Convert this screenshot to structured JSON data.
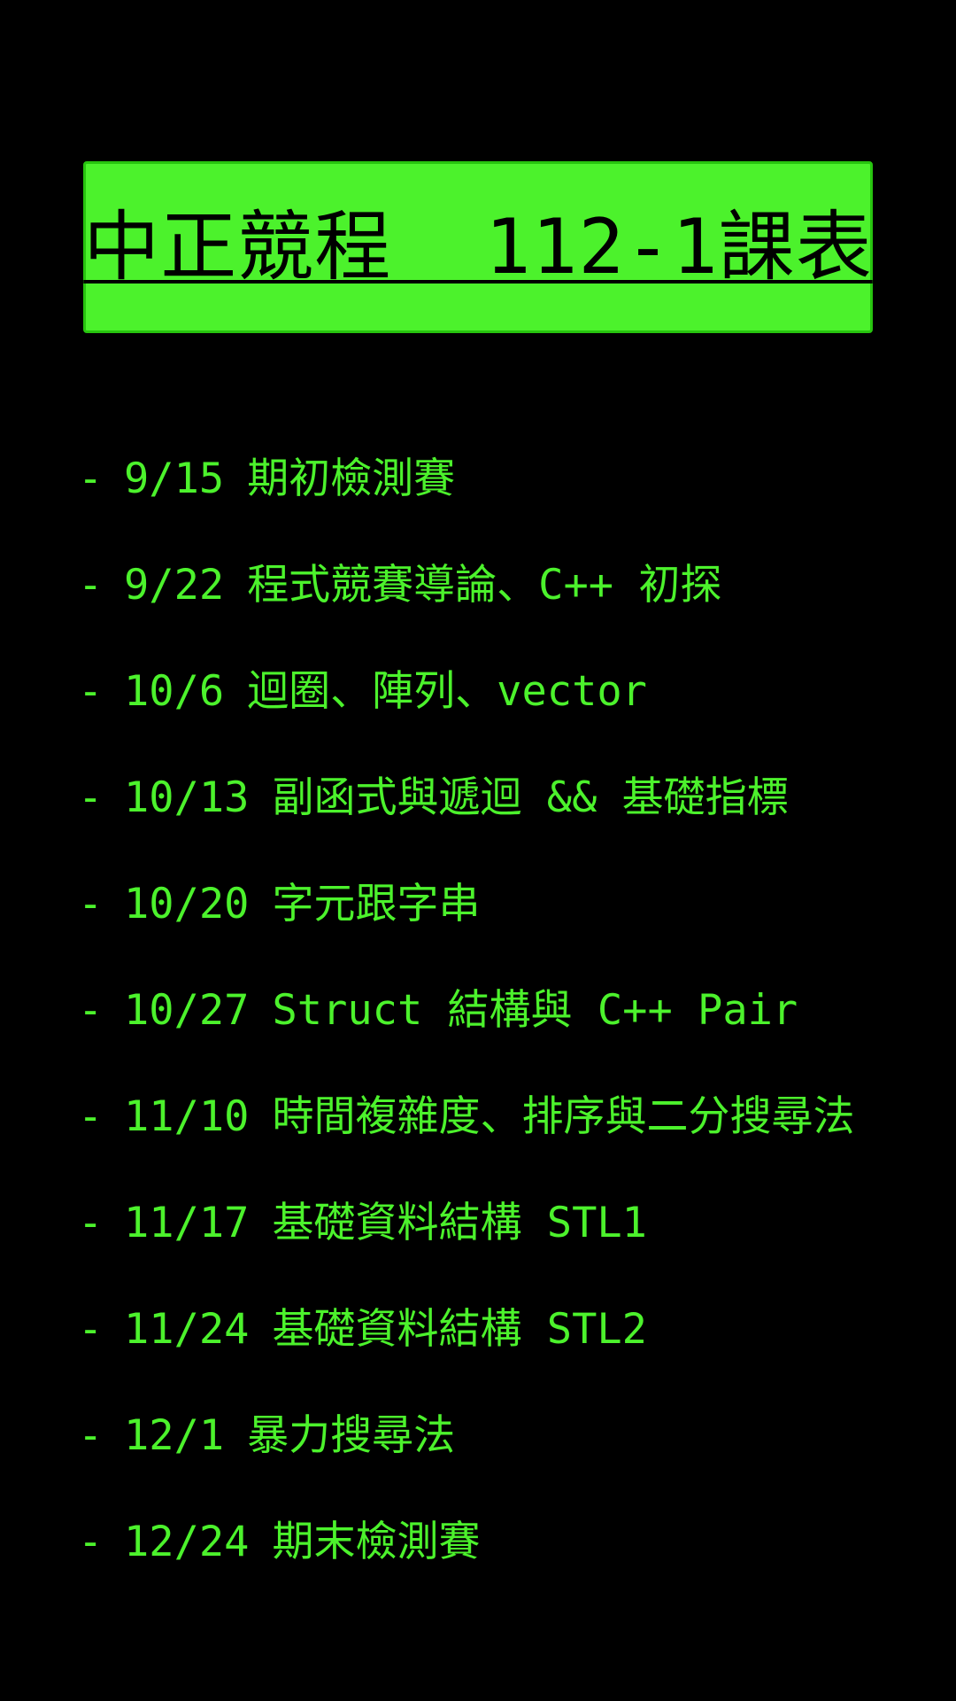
{
  "title": "中正競程  112-1課表",
  "colors": {
    "background": "#000000",
    "accent": "#4cf22c",
    "title_text": "#000000"
  },
  "schedule": {
    "bullet": "-",
    "items": [
      {
        "date": "9/15",
        "topic": "期初檢測賽"
      },
      {
        "date": "9/22",
        "topic": "程式競賽導論、C++ 初探"
      },
      {
        "date": "10/6",
        "topic": "迴圈、陣列、vector"
      },
      {
        "date": "10/13",
        "topic": "副函式與遞迴 && 基礎指標"
      },
      {
        "date": "10/20",
        "topic": "字元跟字串"
      },
      {
        "date": "10/27",
        "topic": "Struct 結構與 C++ Pair"
      },
      {
        "date": "11/10",
        "topic": "時間複雜度、排序與二分搜尋法"
      },
      {
        "date": "11/17",
        "topic": "基礎資料結構 STL1"
      },
      {
        "date": "11/24",
        "topic": "基礎資料結構 STL2"
      },
      {
        "date": "12/1",
        "topic": "暴力搜尋法"
      },
      {
        "date": "12/24",
        "topic": "期末檢測賽"
      }
    ]
  }
}
